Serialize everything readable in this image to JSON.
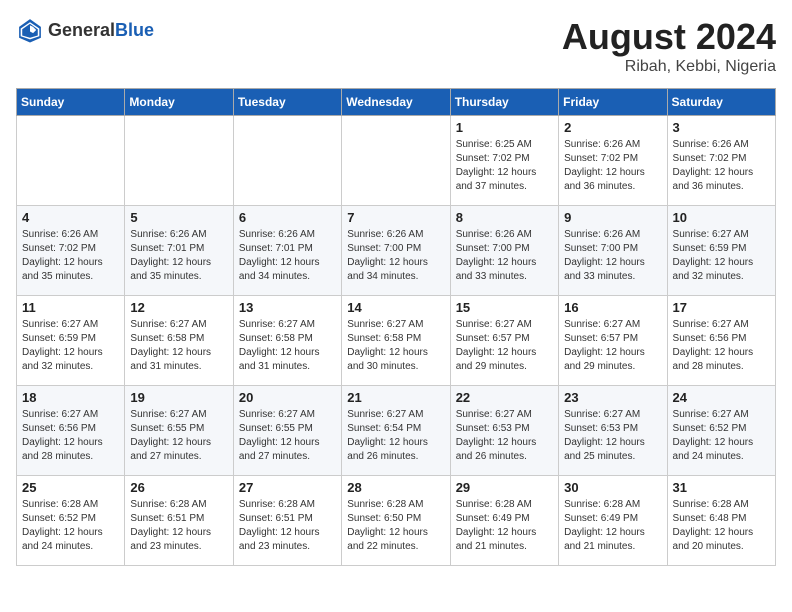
{
  "logo": {
    "text_general": "General",
    "text_blue": "Blue"
  },
  "title": {
    "month_year": "August 2024",
    "location": "Ribah, Kebbi, Nigeria"
  },
  "days_of_week": [
    "Sunday",
    "Monday",
    "Tuesday",
    "Wednesday",
    "Thursday",
    "Friday",
    "Saturday"
  ],
  "weeks": [
    [
      {
        "day": "",
        "detail": ""
      },
      {
        "day": "",
        "detail": ""
      },
      {
        "day": "",
        "detail": ""
      },
      {
        "day": "",
        "detail": ""
      },
      {
        "day": "1",
        "detail": "Sunrise: 6:25 AM\nSunset: 7:02 PM\nDaylight: 12 hours\nand 37 minutes."
      },
      {
        "day": "2",
        "detail": "Sunrise: 6:26 AM\nSunset: 7:02 PM\nDaylight: 12 hours\nand 36 minutes."
      },
      {
        "day": "3",
        "detail": "Sunrise: 6:26 AM\nSunset: 7:02 PM\nDaylight: 12 hours\nand 36 minutes."
      }
    ],
    [
      {
        "day": "4",
        "detail": "Sunrise: 6:26 AM\nSunset: 7:02 PM\nDaylight: 12 hours\nand 35 minutes."
      },
      {
        "day": "5",
        "detail": "Sunrise: 6:26 AM\nSunset: 7:01 PM\nDaylight: 12 hours\nand 35 minutes."
      },
      {
        "day": "6",
        "detail": "Sunrise: 6:26 AM\nSunset: 7:01 PM\nDaylight: 12 hours\nand 34 minutes."
      },
      {
        "day": "7",
        "detail": "Sunrise: 6:26 AM\nSunset: 7:00 PM\nDaylight: 12 hours\nand 34 minutes."
      },
      {
        "day": "8",
        "detail": "Sunrise: 6:26 AM\nSunset: 7:00 PM\nDaylight: 12 hours\nand 33 minutes."
      },
      {
        "day": "9",
        "detail": "Sunrise: 6:26 AM\nSunset: 7:00 PM\nDaylight: 12 hours\nand 33 minutes."
      },
      {
        "day": "10",
        "detail": "Sunrise: 6:27 AM\nSunset: 6:59 PM\nDaylight: 12 hours\nand 32 minutes."
      }
    ],
    [
      {
        "day": "11",
        "detail": "Sunrise: 6:27 AM\nSunset: 6:59 PM\nDaylight: 12 hours\nand 32 minutes."
      },
      {
        "day": "12",
        "detail": "Sunrise: 6:27 AM\nSunset: 6:58 PM\nDaylight: 12 hours\nand 31 minutes."
      },
      {
        "day": "13",
        "detail": "Sunrise: 6:27 AM\nSunset: 6:58 PM\nDaylight: 12 hours\nand 31 minutes."
      },
      {
        "day": "14",
        "detail": "Sunrise: 6:27 AM\nSunset: 6:58 PM\nDaylight: 12 hours\nand 30 minutes."
      },
      {
        "day": "15",
        "detail": "Sunrise: 6:27 AM\nSunset: 6:57 PM\nDaylight: 12 hours\nand 29 minutes."
      },
      {
        "day": "16",
        "detail": "Sunrise: 6:27 AM\nSunset: 6:57 PM\nDaylight: 12 hours\nand 29 minutes."
      },
      {
        "day": "17",
        "detail": "Sunrise: 6:27 AM\nSunset: 6:56 PM\nDaylight: 12 hours\nand 28 minutes."
      }
    ],
    [
      {
        "day": "18",
        "detail": "Sunrise: 6:27 AM\nSunset: 6:56 PM\nDaylight: 12 hours\nand 28 minutes."
      },
      {
        "day": "19",
        "detail": "Sunrise: 6:27 AM\nSunset: 6:55 PM\nDaylight: 12 hours\nand 27 minutes."
      },
      {
        "day": "20",
        "detail": "Sunrise: 6:27 AM\nSunset: 6:55 PM\nDaylight: 12 hours\nand 27 minutes."
      },
      {
        "day": "21",
        "detail": "Sunrise: 6:27 AM\nSunset: 6:54 PM\nDaylight: 12 hours\nand 26 minutes."
      },
      {
        "day": "22",
        "detail": "Sunrise: 6:27 AM\nSunset: 6:53 PM\nDaylight: 12 hours\nand 26 minutes."
      },
      {
        "day": "23",
        "detail": "Sunrise: 6:27 AM\nSunset: 6:53 PM\nDaylight: 12 hours\nand 25 minutes."
      },
      {
        "day": "24",
        "detail": "Sunrise: 6:27 AM\nSunset: 6:52 PM\nDaylight: 12 hours\nand 24 minutes."
      }
    ],
    [
      {
        "day": "25",
        "detail": "Sunrise: 6:28 AM\nSunset: 6:52 PM\nDaylight: 12 hours\nand 24 minutes."
      },
      {
        "day": "26",
        "detail": "Sunrise: 6:28 AM\nSunset: 6:51 PM\nDaylight: 12 hours\nand 23 minutes."
      },
      {
        "day": "27",
        "detail": "Sunrise: 6:28 AM\nSunset: 6:51 PM\nDaylight: 12 hours\nand 23 minutes."
      },
      {
        "day": "28",
        "detail": "Sunrise: 6:28 AM\nSunset: 6:50 PM\nDaylight: 12 hours\nand 22 minutes."
      },
      {
        "day": "29",
        "detail": "Sunrise: 6:28 AM\nSunset: 6:49 PM\nDaylight: 12 hours\nand 21 minutes."
      },
      {
        "day": "30",
        "detail": "Sunrise: 6:28 AM\nSunset: 6:49 PM\nDaylight: 12 hours\nand 21 minutes."
      },
      {
        "day": "31",
        "detail": "Sunrise: 6:28 AM\nSunset: 6:48 PM\nDaylight: 12 hours\nand 20 minutes."
      }
    ]
  ]
}
